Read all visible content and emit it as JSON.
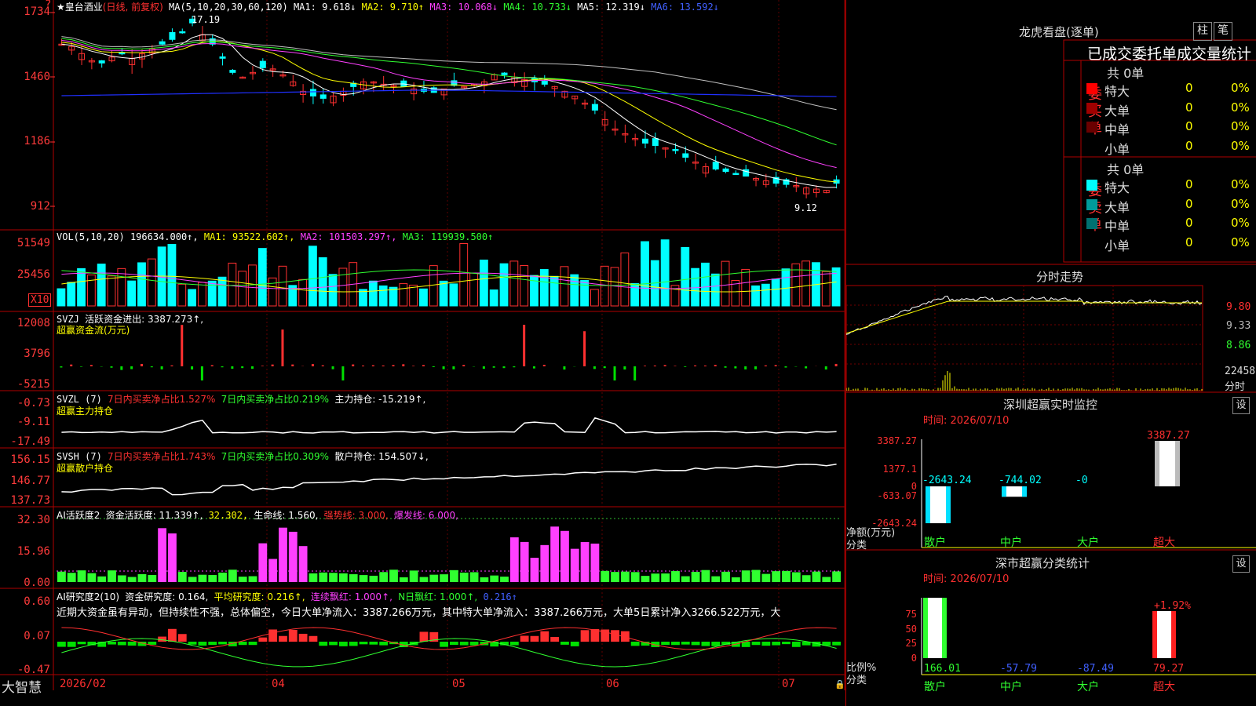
{
  "colors": {
    "up": "#ff3030",
    "down": "#00ffff",
    "grid": "#b00000",
    "ma1": "#ffffff",
    "ma2": "#ffff00",
    "ma3": "#ff40ff",
    "ma4": "#30ff30",
    "ma5": "#c0c0c0",
    "ma6": "#2030ff"
  },
  "main": {
    "title": "★皇台酒业",
    "mode": "(日线, 前复权)",
    "ma_set": "MA(5,10,20,30,60,120)",
    "ma1": "MA1: 9.618↓",
    "ma2": "MA2: 9.710↑",
    "ma3": "MA3: 10.068↓",
    "ma4": "MA4: 10.733↓",
    "ma5": "MA5: 12.319↓",
    "ma6": "MA6: 13.592↓",
    "high_mark": "17.19",
    "low_mark": "9.12",
    "axis": [
      "1734",
      "1460",
      "1186",
      "912"
    ]
  },
  "vol": {
    "label": "VOL(5,10,20)",
    "v": "196634.000↑,",
    "ma1": "MA1: 93522.602↑,",
    "ma2": "MA2: 101503.297↑,",
    "ma3": "MA3: 119939.500↑",
    "axis": [
      "51549",
      "25456"
    ],
    "unit": "X10"
  },
  "svzj": {
    "label": "SVZJ",
    "name": "活跃资金进出: 3387.273↑,",
    "sub": "超赢资金流(万元)",
    "axis": [
      "12008",
      "3796",
      "-5215"
    ]
  },
  "svzl": {
    "label": "SVZL (7)",
    "a": "7日内买卖净占比1.527%",
    "b": "7日内买卖净占比0.219%",
    "c": "主力持仓: -15.219↑,",
    "sub": "超赢主力持仓",
    "axis": [
      "-0.73",
      "-9.11",
      "-17.49"
    ]
  },
  "svsh": {
    "label": "SVSH (7)",
    "a": "7日内买卖净占比1.743%",
    "b": "7日内买卖净占比0.309%",
    "c": "散户持仓: 154.507↓,",
    "sub": "超赢散户持仓",
    "axis": [
      "156.15",
      "146.77",
      "137.73"
    ]
  },
  "ai1": {
    "label": "AI活跃度2",
    "a": "资金活跃度: 11.339↑,",
    "b": "32.302,",
    "c": "生命线: 1.560,",
    "d": "强势线: 3.000,",
    "e": "爆发线: 6.000,",
    "axis": [
      "32.30",
      "15.96",
      "0.00"
    ]
  },
  "ai2": {
    "label": "AI研究度2(10)",
    "a": "资金研究度: 0.164,",
    "b": "平均研究度: 0.216↑,",
    "c": "连续飘红: 1.000↑,",
    "d": "N日飘红: 1.000↑,",
    "e": "0.216↑",
    "axis": [
      "0.60",
      "0.07",
      "-0.47"
    ],
    "comment": "近期大资金虽有异动，但持续性不强，总体偏空，今日大单净流入：3387.266万元，其中特大单净流入：3387.266万元，大单5日累计净入3266.522万元，大"
  },
  "xaxis": {
    "app": "大智慧",
    "labels": [
      "2026/02",
      "04",
      "05",
      "06",
      "07"
    ]
  },
  "right": {
    "lh_title": "龙虎看盘(逐单)",
    "btn_zhu": "柱",
    "btn_bi": "笔",
    "stat_title": "已成交委托单成交量统计",
    "buy_side": "委买单",
    "sell_side": "委卖单",
    "buy_total": "共 0单",
    "sell_total": "共 0单",
    "rows": [
      {
        "name": "特大",
        "count": "0",
        "pct": "0%",
        "buy_color": "#ff0000",
        "sell_color": "#00ffff"
      },
      {
        "name": "大单",
        "count": "0",
        "pct": "0%",
        "buy_color": "#a00000",
        "sell_color": "#009a9a"
      },
      {
        "name": "中单",
        "count": "0",
        "pct": "0%",
        "buy_color": "#6a0000",
        "sell_color": "#007070"
      },
      {
        "name": "小单",
        "count": "0",
        "pct": "0%",
        "buy_color": "#000000",
        "sell_color": "#000000"
      }
    ],
    "fs_title": "分时走势",
    "fs_axis": [
      "9.80",
      "9.33",
      "8.86"
    ],
    "fs_vol": "22458",
    "fs_unit": "分时",
    "sz_title": "深圳超赢实时监控",
    "sz_set": "设",
    "sz_time": "时间: 2026/07/10",
    "sz_axis": [
      "3387.27",
      "1377.1",
      "0",
      "-633.07",
      "-2643.24"
    ],
    "sz_values": [
      {
        "cat": "散户",
        "v": -2643.24,
        "label": "-2643.24"
      },
      {
        "cat": "中户",
        "v": -744.02,
        "label": "-744.02"
      },
      {
        "cat": "大户",
        "v": 0,
        "label": "-0"
      },
      {
        "cat": "超大",
        "v": 3387.27,
        "label": "3387.27"
      }
    ],
    "sz_ylabel": "净额(万元)",
    "sz_xlabel": "分类",
    "sc_title": "深市超赢分类统计",
    "sc_set": "设",
    "sc_time": "时间: 2026/07/10",
    "sc_axis": [
      "75",
      "50",
      "25",
      "0"
    ],
    "sc_top": "+1.92%",
    "sc_values": [
      {
        "cat": "散户",
        "v": 166.01,
        "label": "166.01"
      },
      {
        "cat": "中户",
        "v": -57.79,
        "label": "-57.79"
      },
      {
        "cat": "大户",
        "v": -87.49,
        "label": "-87.49"
      },
      {
        "cat": "超大",
        "v": 79.27,
        "label": "79.27"
      }
    ],
    "sc_ylabel": "比例%",
    "sc_xlabel": "分类"
  }
}
